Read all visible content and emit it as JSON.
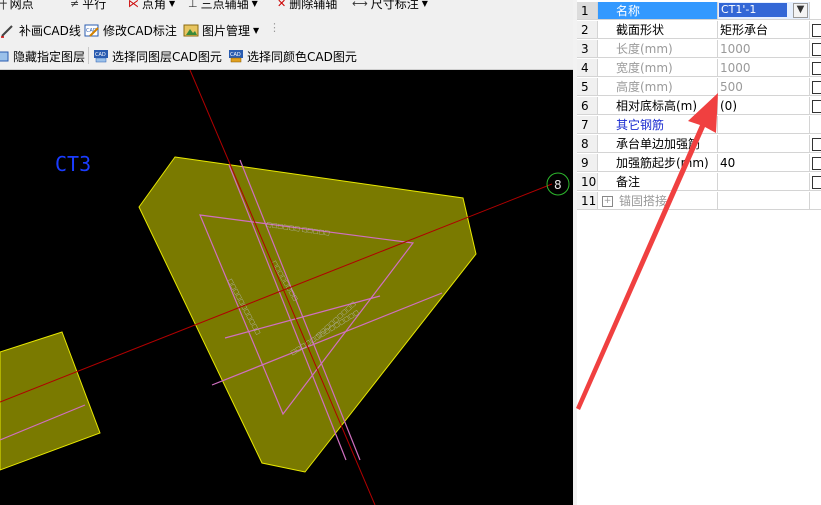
{
  "toolbar_top": {
    "items": [
      "网点",
      "平行",
      "点角",
      "三点辅轴",
      "删除辅轴",
      "尺寸标注"
    ]
  },
  "toolbar_mid": {
    "items": [
      "补画CAD线",
      "修改CAD标注",
      "图片管理"
    ]
  },
  "toolbar_bottom": {
    "items": [
      "隐藏指定图层",
      "选择同图层CAD图元",
      "选择同颜色CAD图元"
    ]
  },
  "canvas": {
    "label_ct3": "CT3",
    "axis_marker": "8",
    "colors": {
      "background": "#000000",
      "fill": "#7a7a00",
      "outline": "#e8e800",
      "axis": "#b00000",
      "rebar": "#d070c0",
      "label": "#1a3cff",
      "arrow": "#f04040"
    }
  },
  "properties": {
    "rows": [
      {
        "num": "1",
        "name": "名称",
        "value": "CT1'-1",
        "checkbox": false,
        "selected": true,
        "style": "normal"
      },
      {
        "num": "2",
        "name": "截面形状",
        "value": "矩形承台",
        "checkbox": true,
        "style": "normal"
      },
      {
        "num": "3",
        "name": "长度(mm)",
        "value": "1000",
        "checkbox": true,
        "style": "gray"
      },
      {
        "num": "4",
        "name": "宽度(mm)",
        "value": "1000",
        "checkbox": true,
        "style": "gray"
      },
      {
        "num": "5",
        "name": "高度(mm)",
        "value": "500",
        "checkbox": true,
        "style": "gray"
      },
      {
        "num": "6",
        "name": "相对底标高(m)",
        "value": "(0)",
        "checkbox": true,
        "style": "normal"
      },
      {
        "num": "7",
        "name": "其它钢筋",
        "value": "",
        "checkbox": false,
        "style": "blue"
      },
      {
        "num": "8",
        "name": "承台单边加强筋",
        "value": "",
        "checkbox": true,
        "style": "normal"
      },
      {
        "num": "9",
        "name": "加强筋起步(mm)",
        "value": "40",
        "checkbox": true,
        "style": "normal"
      },
      {
        "num": "10",
        "name": "备注",
        "value": "",
        "checkbox": true,
        "style": "normal"
      },
      {
        "num": "11",
        "name": "锚固搭接",
        "value": "",
        "checkbox": false,
        "style": "gray",
        "expandable": true
      }
    ]
  }
}
